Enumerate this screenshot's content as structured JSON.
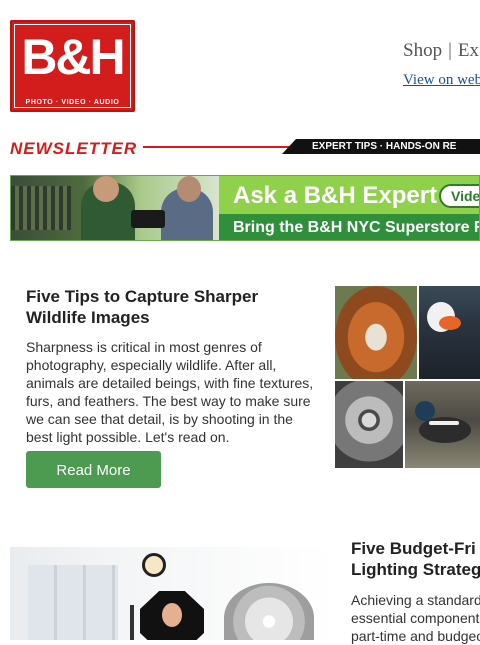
{
  "logo": {
    "mark": "B&H",
    "subline": "PHOTO · VIDEO · AUDIO"
  },
  "header": {
    "links": [
      "Shop",
      "Ex"
    ],
    "separator": "|",
    "view_on_web": "View on web"
  },
  "newsletter": {
    "word": "NEWSLETTER",
    "tagline": "EXPERT TIPS · HANDS-ON RE"
  },
  "banner": {
    "title": "Ask a B&H Expert",
    "button": "Video",
    "subtitle": "Bring the B&H NYC Superstore Ri"
  },
  "article1": {
    "title": "Five Tips to Capture Sharper Wildlife Images",
    "body": "Sharpness is critical in most genres of photography, especially wildlife. After all, animals are detailed beings, with fine textures, furs, and feathers. The best way to make sure we can see that detail, is by shooting in the best light possible. Let's read on.",
    "button": "Read More"
  },
  "article2": {
    "title_line1": "Five Budget-Fri",
    "title_line2": "Lighting Strateg",
    "body_line1": "Achieving a standard",
    "body_line2": "essential component",
    "body_line3": "part-time and budgeo"
  },
  "colors": {
    "brand_red": "#d31c1c",
    "button_green": "#4d9a51",
    "banner_green": "#8fd14a",
    "link_blue": "#1a4fa0"
  },
  "icons": {
    "logo": "bh-logo"
  }
}
